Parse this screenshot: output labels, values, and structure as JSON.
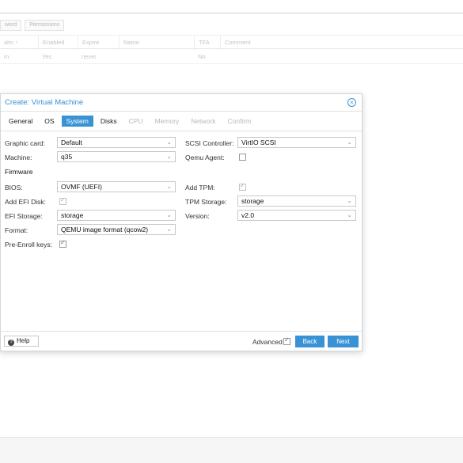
{
  "background": {
    "toolbar": [
      "word",
      "Permissions"
    ],
    "columns": [
      "alm ↑",
      "Enabled",
      "Expire",
      "Name",
      "TFA",
      "Comment"
    ],
    "row": [
      "m",
      "Yes",
      "never",
      "",
      "No",
      ""
    ]
  },
  "dialog": {
    "title": "Create: Virtual Machine",
    "tabs": [
      {
        "label": "General",
        "state": "normal"
      },
      {
        "label": "OS",
        "state": "normal"
      },
      {
        "label": "System",
        "state": "active"
      },
      {
        "label": "Disks",
        "state": "normal"
      },
      {
        "label": "CPU",
        "state": "disabled"
      },
      {
        "label": "Memory",
        "state": "disabled"
      },
      {
        "label": "Network",
        "state": "disabled"
      },
      {
        "label": "Confirm",
        "state": "disabled"
      }
    ],
    "left": {
      "graphic_card": {
        "label": "Graphic card:",
        "value": "Default"
      },
      "machine": {
        "label": "Machine:",
        "value": "q35"
      },
      "firmware_section": "Firmware",
      "bios": {
        "label": "BIOS:",
        "value": "OVMF (UEFI)"
      },
      "add_efi_disk": {
        "label": "Add EFI Disk:",
        "checked": true
      },
      "efi_storage": {
        "label": "EFI Storage:",
        "value": "storage"
      },
      "format": {
        "label": "Format:",
        "value": "QEMU image format (qcow2)"
      },
      "pre_enroll_keys": {
        "label": "Pre-Enroll keys:",
        "checked": true
      }
    },
    "right": {
      "scsi_controller": {
        "label": "SCSI Controller:",
        "value": "VirtIO SCSI"
      },
      "qemu_agent": {
        "label": "Qemu Agent:",
        "checked": false
      },
      "add_tpm": {
        "label": "Add TPM:",
        "checked": true
      },
      "tpm_storage": {
        "label": "TPM Storage:",
        "value": "storage"
      },
      "version": {
        "label": "Version:",
        "value": "v2.0"
      }
    },
    "footer": {
      "help": "Help",
      "advanced": "Advanced",
      "advanced_checked": true,
      "back": "Back",
      "next": "Next"
    }
  },
  "colors": {
    "accent": "#3892d4"
  }
}
